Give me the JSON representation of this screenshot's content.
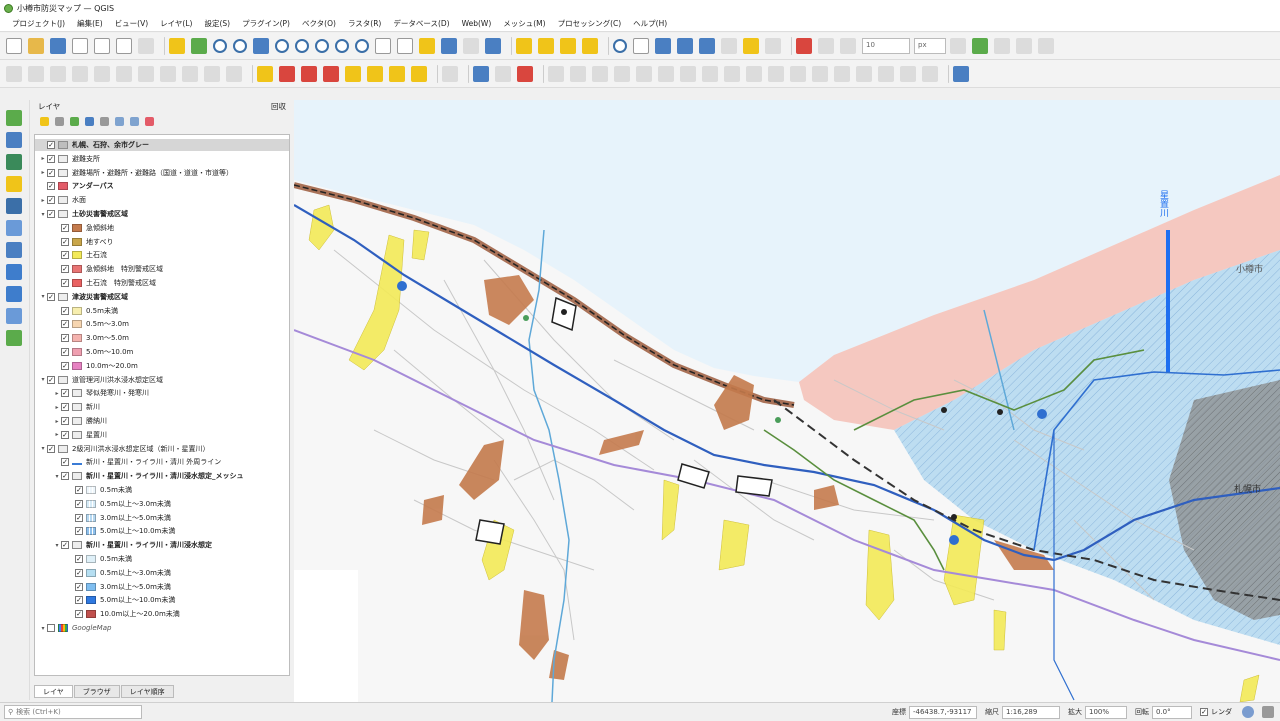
{
  "window": {
    "title": "小樽市防災マップ — QGIS"
  },
  "menu": [
    "プロジェクト(J)",
    "編集(E)",
    "ビュー(V)",
    "レイヤ(L)",
    "設定(S)",
    "プラグイン(P)",
    "ベクタ(O)",
    "ラスタ(R)",
    "データベース(D)",
    "Web(W)",
    "メッシュ(M)",
    "プロセッシング(C)",
    "ヘルプ(H)"
  ],
  "toolbar": {
    "scale_input": "10",
    "unit_select": "px"
  },
  "layer_panel": {
    "title": "レイヤ",
    "close_label": "回収",
    "layers": [
      {
        "label": "札幌、石狩、余市グレー",
        "indent": 0,
        "arrow": "",
        "checked": true,
        "swatch": "#bdbdbd",
        "style": "bold",
        "selected": true
      },
      {
        "label": "避難支所",
        "indent": 0,
        "arrow": "▸",
        "checked": true,
        "swatch": "group"
      },
      {
        "label": "避難場所・避難所・避難路（国道・道道・市道等）",
        "indent": 0,
        "arrow": "▸",
        "checked": true,
        "swatch": "group"
      },
      {
        "label": "アンダーパス",
        "indent": 0,
        "arrow": "",
        "checked": true,
        "swatch": "#e35b68",
        "style": "bold"
      },
      {
        "label": "水面",
        "indent": 0,
        "arrow": "▸",
        "checked": true,
        "swatch": "group"
      },
      {
        "label": "土砂災害警戒区域",
        "indent": 0,
        "arrow": "▾",
        "checked": true,
        "swatch": "group",
        "style": "bold"
      },
      {
        "label": "急傾斜地",
        "indent": 1,
        "arrow": "",
        "checked": true,
        "swatch": "#c47a4c"
      },
      {
        "label": "地すべり",
        "indent": 1,
        "arrow": "",
        "checked": true,
        "swatch": "#c9a64a"
      },
      {
        "label": "土石流",
        "indent": 1,
        "arrow": "",
        "checked": true,
        "swatch": "#f3ea58"
      },
      {
        "label": "急傾斜地　特別警戒区域",
        "indent": 1,
        "arrow": "",
        "checked": true,
        "swatch": "#e87474"
      },
      {
        "label": "土石流　特別警戒区域",
        "indent": 1,
        "arrow": "",
        "checked": true,
        "swatch": "#e96262"
      },
      {
        "label": "津波災害警戒区域",
        "indent": 0,
        "arrow": "▾",
        "checked": true,
        "swatch": "group",
        "style": "bold"
      },
      {
        "label": "0.5m未満",
        "indent": 1,
        "arrow": "",
        "checked": true,
        "swatch": "#f7eeae"
      },
      {
        "label": "0.5m～3.0m",
        "indent": 1,
        "arrow": "",
        "checked": true,
        "swatch": "#f6d5b0"
      },
      {
        "label": "3.0m～5.0m",
        "indent": 1,
        "arrow": "",
        "checked": true,
        "swatch": "#f4b2ae"
      },
      {
        "label": "5.0m～10.0m",
        "indent": 1,
        "arrow": "",
        "checked": true,
        "swatch": "#ef9fb0"
      },
      {
        "label": "10.0m～20.0m",
        "indent": 1,
        "arrow": "",
        "checked": true,
        "swatch": "#e682c2"
      },
      {
        "label": "道管理河川洪水浸水想定区域",
        "indent": 0,
        "arrow": "▾",
        "checked": true,
        "swatch": "group"
      },
      {
        "label": "琴似発寒川・発寒川",
        "indent": 1,
        "arrow": "▸",
        "checked": true,
        "swatch": "group"
      },
      {
        "label": "新川",
        "indent": 1,
        "arrow": "▸",
        "checked": true,
        "swatch": "group"
      },
      {
        "label": "勝納川",
        "indent": 1,
        "arrow": "▸",
        "checked": true,
        "swatch": "group"
      },
      {
        "label": "星置川",
        "indent": 1,
        "arrow": "▸",
        "checked": true,
        "swatch": "group"
      },
      {
        "label": "2級河川洪水浸水想定区域（新川・星置川）",
        "indent": 0,
        "arrow": "▾",
        "checked": true,
        "swatch": "group"
      },
      {
        "label": "新川・星置川・ライラ川・清川 外周ライン",
        "indent": 1,
        "arrow": "",
        "checked": true,
        "swatch": "line"
      },
      {
        "label": "新川・星置川・ライラ川・清川浸水想定_メッシュ",
        "indent": 1,
        "arrow": "▾",
        "checked": true,
        "swatch": "group",
        "style": "bold"
      },
      {
        "label": "0.5m未満",
        "indent": 2,
        "arrow": "",
        "checked": true,
        "swatch": "mesh1"
      },
      {
        "label": "0.5m以上～3.0m未満",
        "indent": 2,
        "arrow": "",
        "checked": true,
        "swatch": "mesh2"
      },
      {
        "label": "3.0m以上～5.0m未満",
        "indent": 2,
        "arrow": "",
        "checked": true,
        "swatch": "mesh3"
      },
      {
        "label": "5.0m以上～10.0m未満",
        "indent": 2,
        "arrow": "",
        "checked": true,
        "swatch": "mesh4"
      },
      {
        "label": "新川・星置川・ライラ川・清川浸水想定",
        "indent": 1,
        "arrow": "▾",
        "checked": true,
        "swatch": "group",
        "style": "bold"
      },
      {
        "label": "0.5m未満",
        "indent": 2,
        "arrow": "",
        "checked": true,
        "swatch": "#dff0f8"
      },
      {
        "label": "0.5m以上～3.0m未満",
        "indent": 2,
        "arrow": "",
        "checked": true,
        "swatch": "#b6dff2"
      },
      {
        "label": "3.0m以上～5.0m未満",
        "indent": 2,
        "arrow": "",
        "checked": true,
        "swatch": "#7fbef0"
      },
      {
        "label": "5.0m以上～10.0m未満",
        "indent": 2,
        "arrow": "",
        "checked": true,
        "swatch": "#2f79e0"
      },
      {
        "label": "10.0m以上～20.0m未満",
        "indent": 2,
        "arrow": "",
        "checked": true,
        "swatch": "#c0504d"
      },
      {
        "label": "GoogleMap",
        "indent": 0,
        "arrow": "▾",
        "checked": false,
        "swatch": "google",
        "style": "italic"
      }
    ],
    "tabs": [
      "レイヤ",
      "ブラウザ",
      "レイヤ順序"
    ]
  },
  "map": {
    "labels": {
      "river": "星置川",
      "otaru": "小樽市",
      "sapporo": "札幌市"
    },
    "colors": {
      "sea": "#e7f3fb",
      "land": "#f7f7f7",
      "tsunami": "#f3b4a8",
      "flood": "#a9d4ef",
      "sapporo": "#8c8c8c",
      "road_main": "#2f5fbf",
      "road_sub": "#a58ad8"
    }
  },
  "status": {
    "search_placeholder": "検索 (Ctrl+K)",
    "coord_label": "座標",
    "coordinate": "-46438.7,-93117",
    "scale_label": "縮尺",
    "scale": "1:16,289",
    "magnifier_label": "拡大",
    "magnifier": "100%",
    "rotation_label": "回転",
    "rotation": "0.0°",
    "render_label": "レンダ"
  }
}
